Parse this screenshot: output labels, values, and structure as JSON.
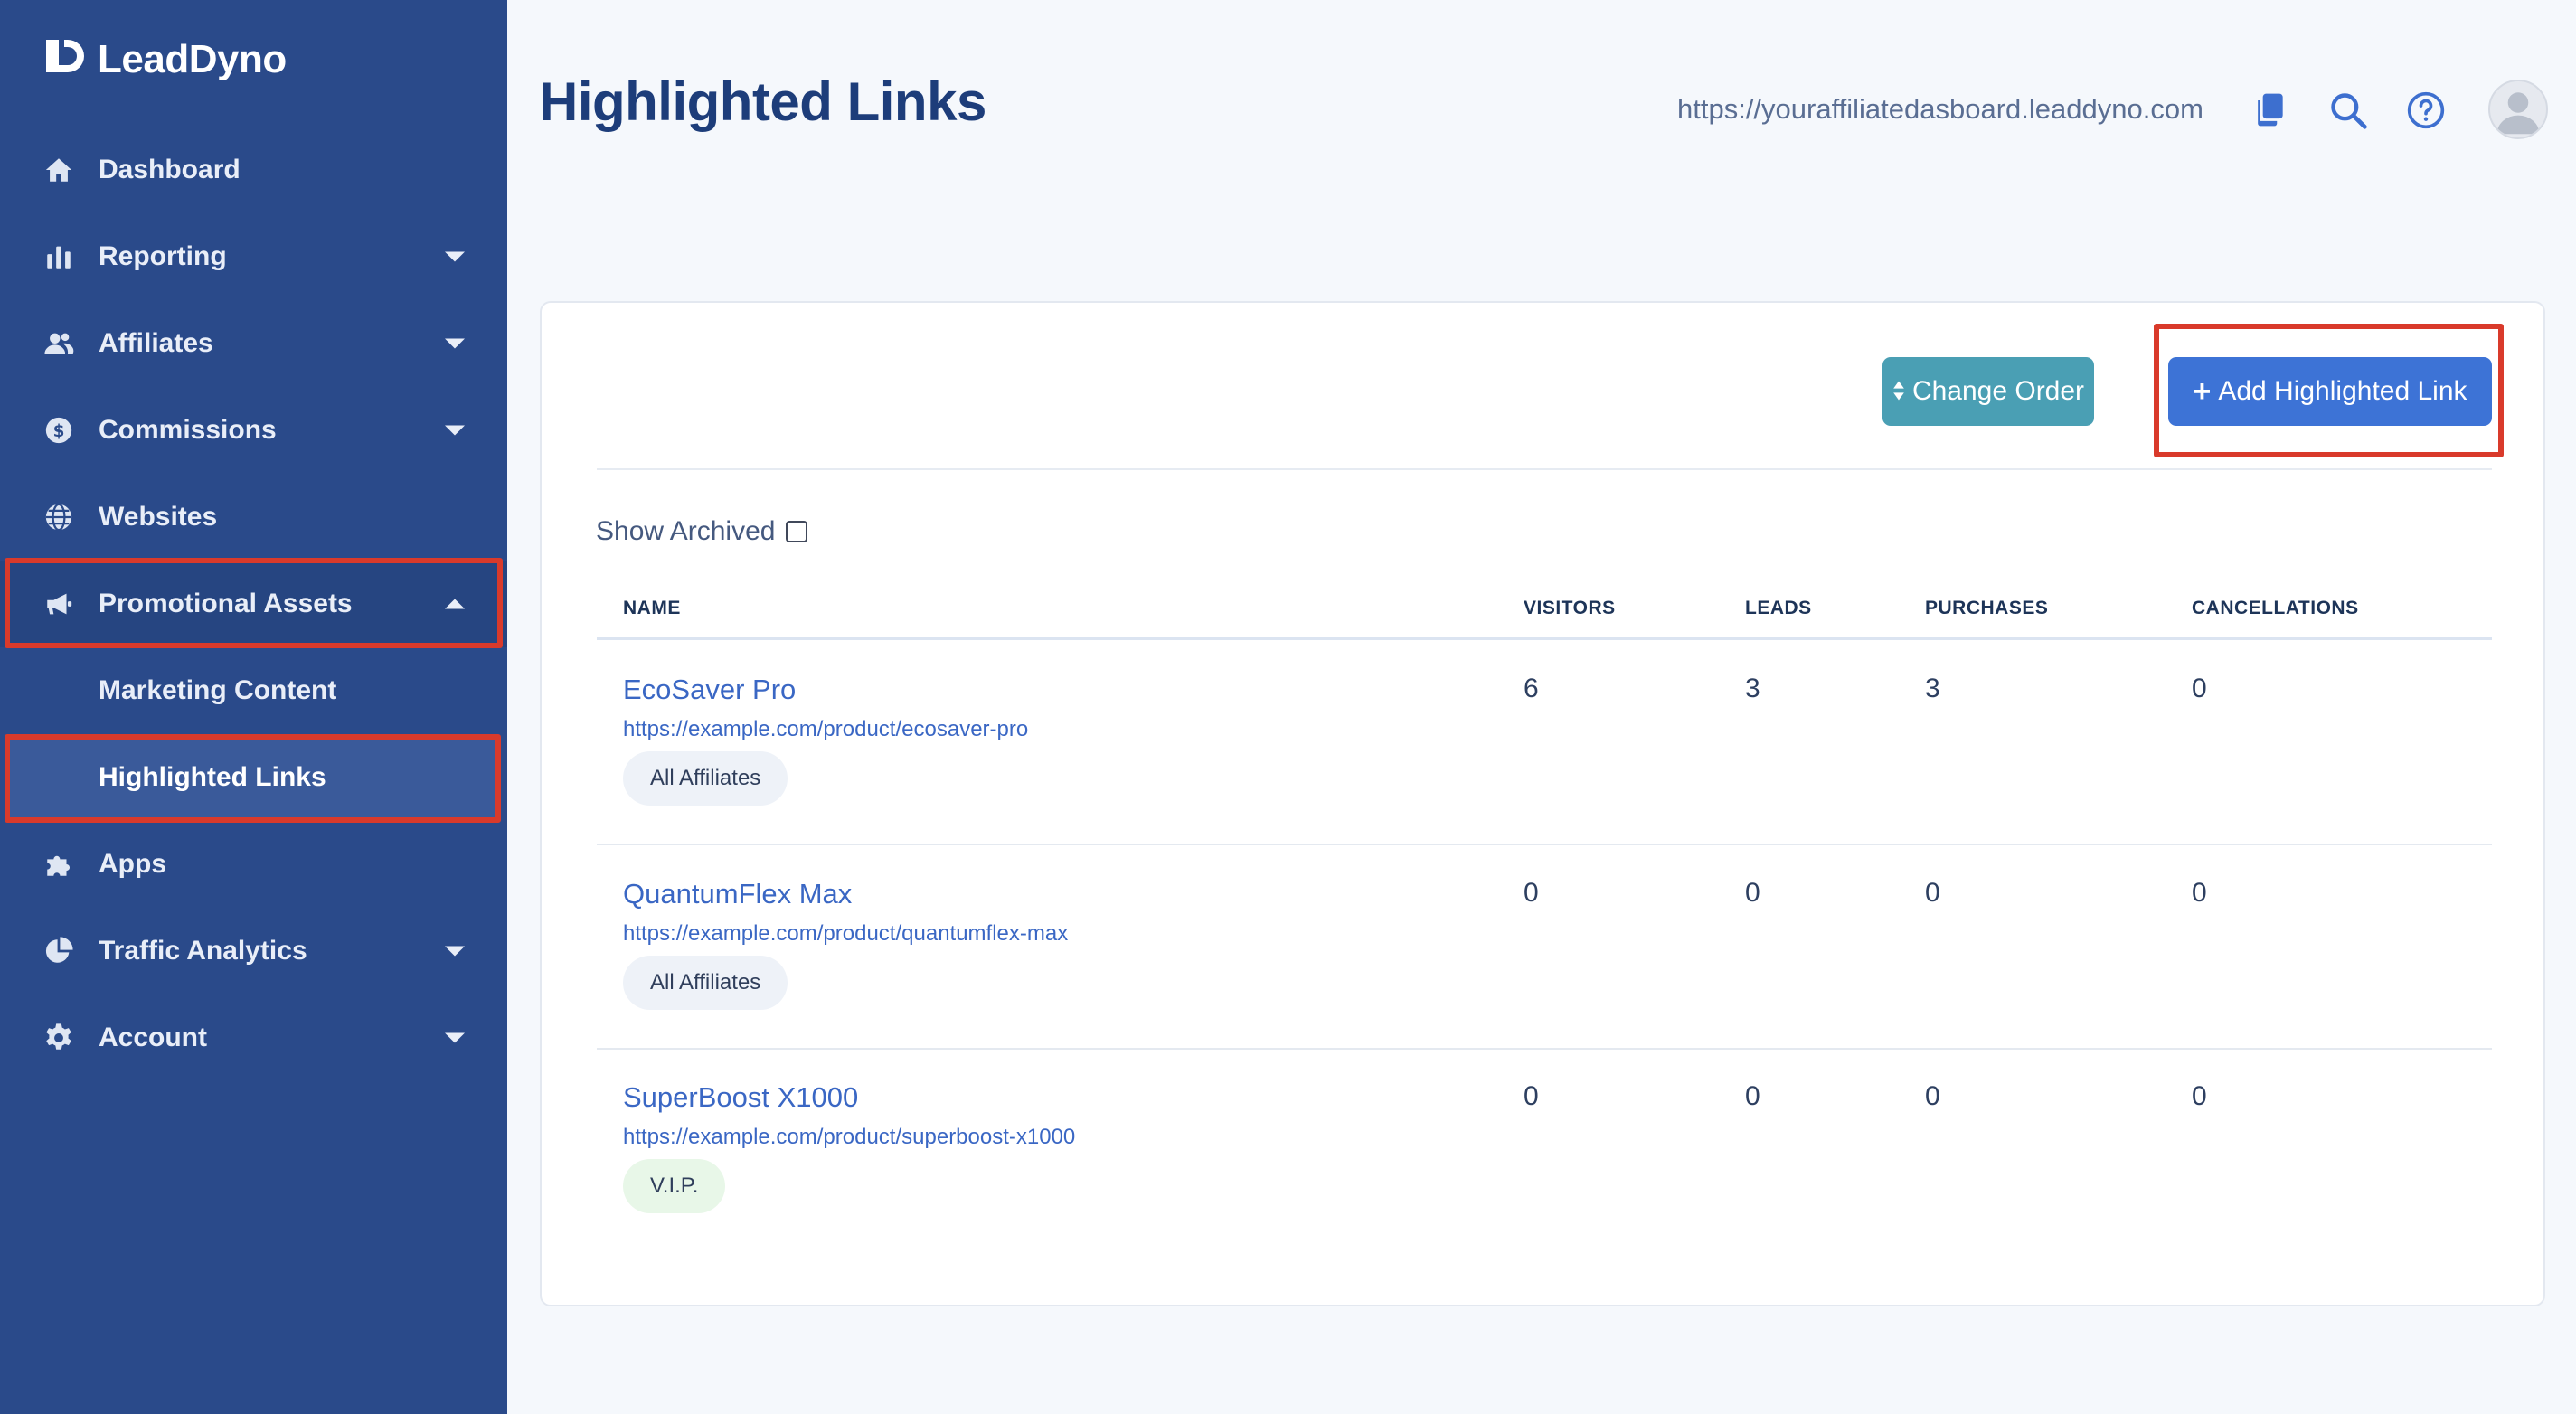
{
  "brand": {
    "name": "LeadDyno"
  },
  "sidebar": {
    "items": [
      {
        "label": "Dashboard"
      },
      {
        "label": "Reporting"
      },
      {
        "label": "Affiliates"
      },
      {
        "label": "Commissions"
      },
      {
        "label": "Websites"
      },
      {
        "label": "Promotional Assets"
      },
      {
        "label": "Marketing Content"
      },
      {
        "label": "Highlighted Links"
      },
      {
        "label": "Apps"
      },
      {
        "label": "Traffic Analytics"
      },
      {
        "label": "Account"
      }
    ]
  },
  "header": {
    "title": "Highlighted Links",
    "dashboard_url": "https://youraffiliatedasboard.leaddyno.com"
  },
  "toolbar": {
    "change_order_label": "Change Order",
    "add_label": "Add Highlighted Link"
  },
  "filters": {
    "show_archived_label": "Show Archived",
    "show_archived_checked": false
  },
  "table": {
    "columns": [
      "NAME",
      "VISITORS",
      "LEADS",
      "PURCHASES",
      "CANCELLATIONS"
    ],
    "rows": [
      {
        "name": "EcoSaver Pro",
        "url": "https://example.com/product/ecosaver-pro",
        "tag": "All Affiliates",
        "visitors": "6",
        "leads": "3",
        "purchases": "3",
        "cancellations": "0"
      },
      {
        "name": "QuantumFlex Max",
        "url": "https://example.com/product/quantumflex-max",
        "tag": "All Affiliates",
        "visitors": "0",
        "leads": "0",
        "purchases": "0",
        "cancellations": "0"
      },
      {
        "name": "SuperBoost X1000",
        "url": "https://example.com/product/superboost-x1000",
        "tag": "V.I.P.",
        "visitors": "0",
        "leads": "0",
        "purchases": "0",
        "cancellations": "0"
      }
    ]
  },
  "colors": {
    "sidebar_bg": "#2a4a8a",
    "title": "#1d3d7a",
    "primary_button": "#3d73d6",
    "secondary_button": "#4a9fb4",
    "link": "#3a67c4",
    "highlight_box": "#d93a2b"
  },
  "icons": {
    "logo": "leaddyno-logo-icon",
    "dashboard": "home-icon",
    "reporting": "bar-chart-icon",
    "affiliates": "users-icon",
    "commissions": "dollar-coin-icon",
    "websites": "globe-icon",
    "promotional_assets": "megaphone-icon",
    "apps": "puzzle-icon",
    "traffic_analytics": "pie-chart-icon",
    "account": "gear-icon",
    "copy": "copy-icon",
    "search": "search-icon",
    "help": "help-icon",
    "avatar": "user-avatar-icon"
  }
}
